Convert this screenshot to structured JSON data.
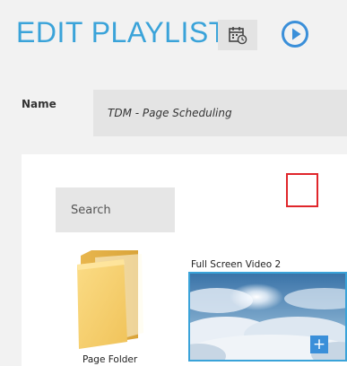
{
  "header": {
    "title": "EDIT PLAYLIST",
    "schedule_icon": "calendar-clock-icon",
    "play_icon": "play-circle-icon",
    "accent_color": "#3aa3d9"
  },
  "form": {
    "name_label": "Name",
    "name_value": "TDM - Page Scheduling"
  },
  "library": {
    "search_placeholder": "Search",
    "items": [
      {
        "type": "folder",
        "label": "Page Folder",
        "icon": "folder-icon"
      },
      {
        "type": "video",
        "label": "Full Screen Video 2",
        "add_icon": "plus-icon",
        "add_label": "+"
      }
    ]
  }
}
